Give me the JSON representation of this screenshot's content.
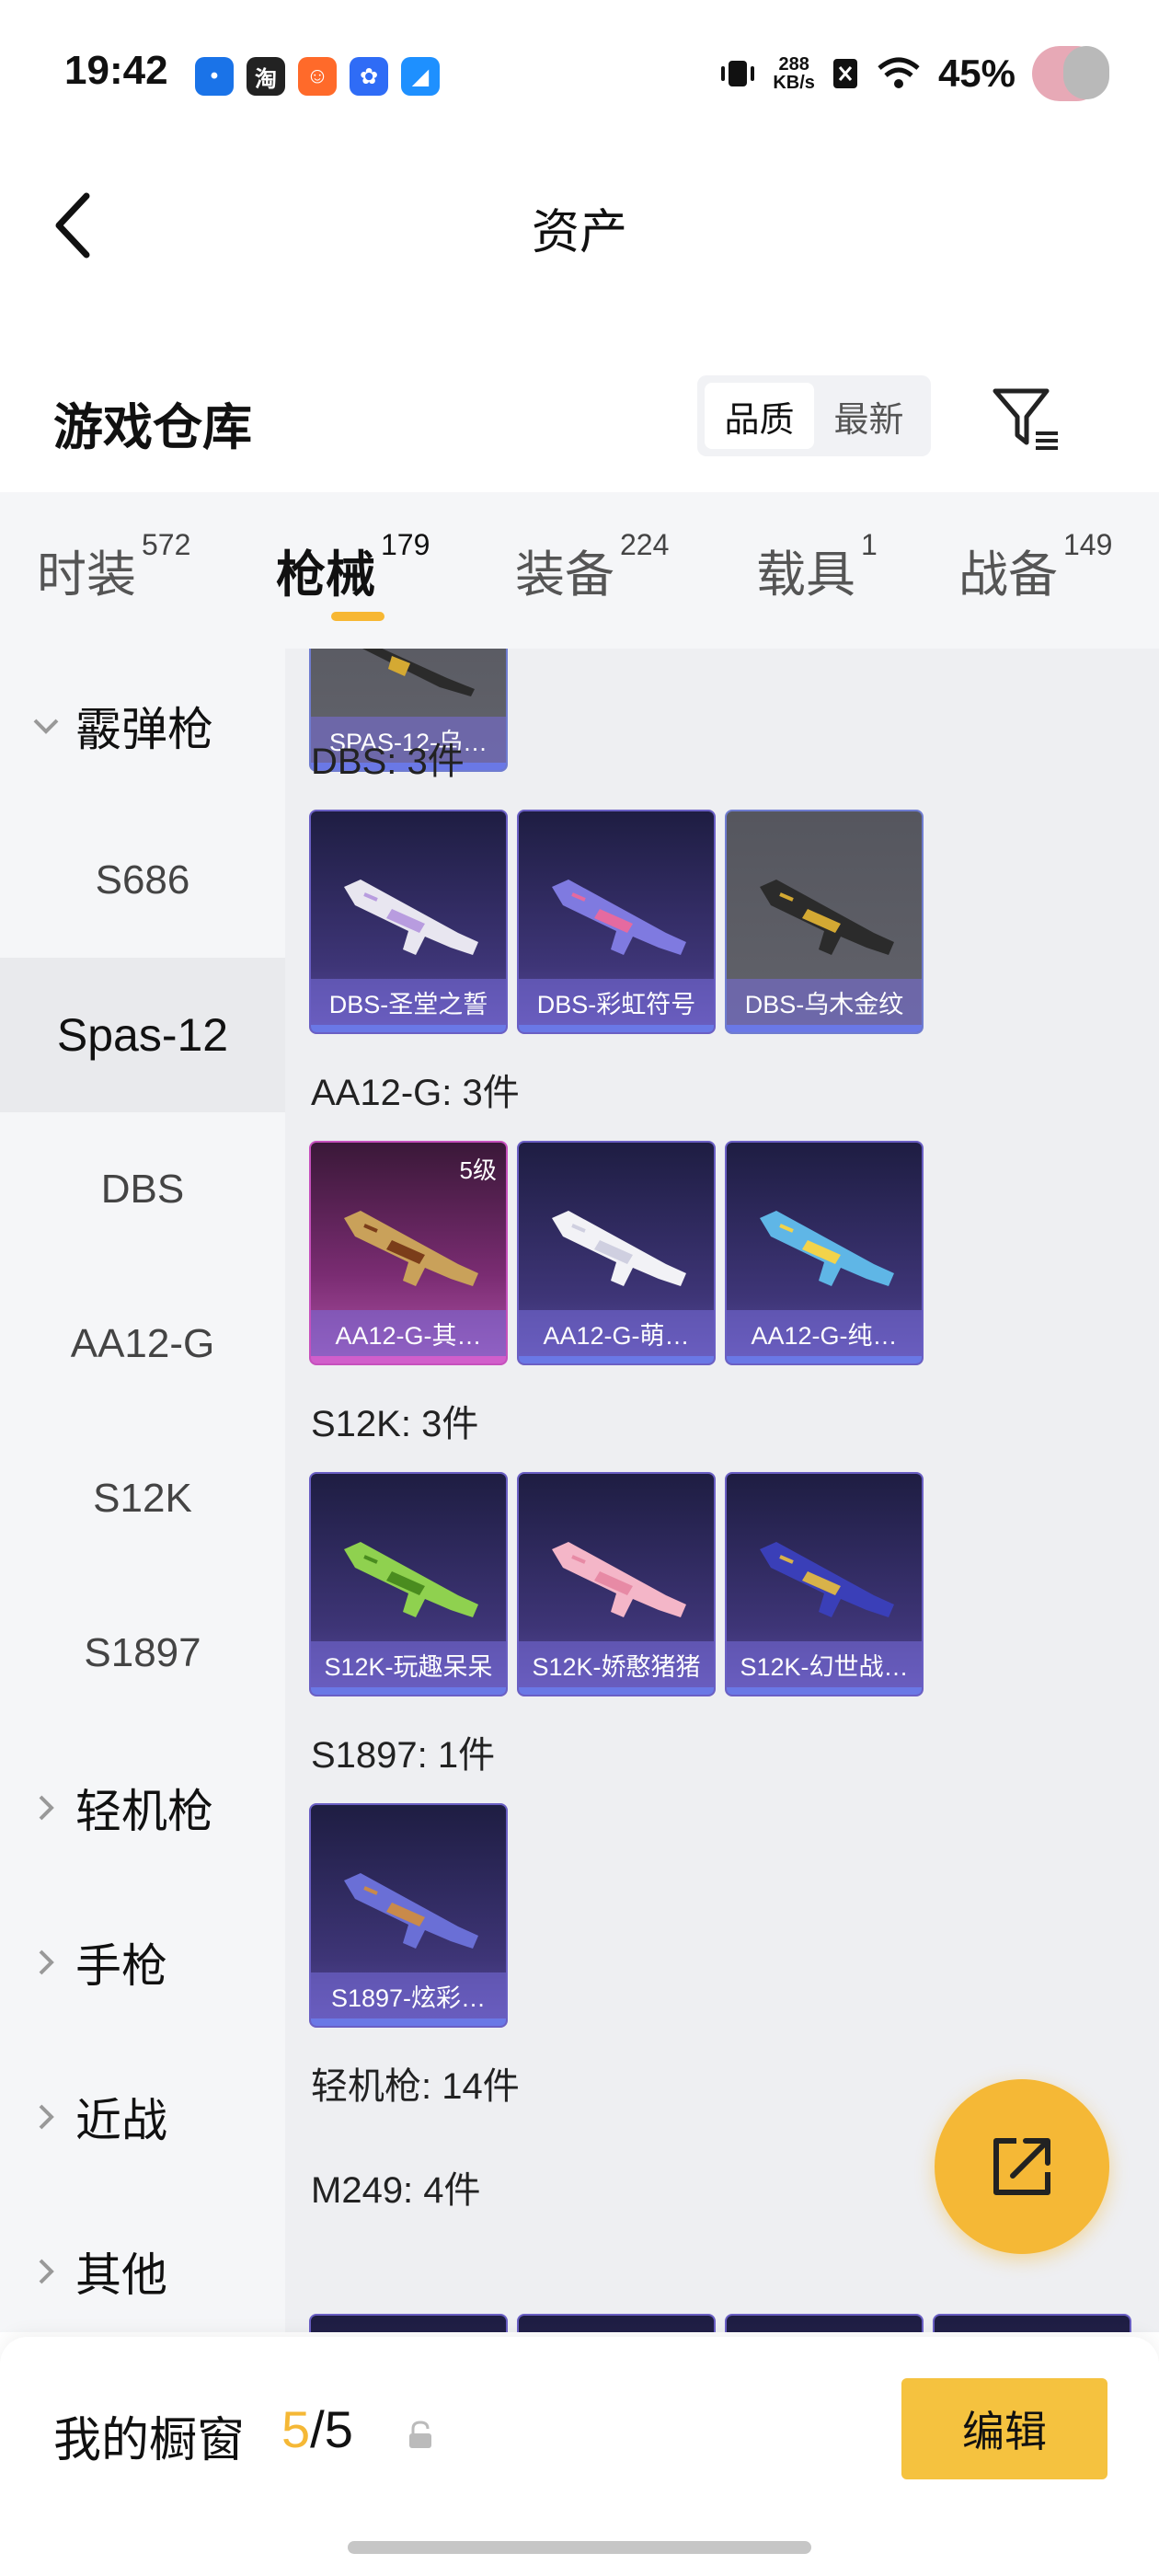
{
  "status_bar": {
    "time": "19:42",
    "net_speed_value": "288",
    "net_speed_unit": "KB/s",
    "battery": "45%",
    "apps": [
      {
        "name": "message-app-icon",
        "glyph": "•",
        "color": "#1a73e8"
      },
      {
        "name": "taobao-app-icon",
        "glyph": "淘",
        "color": "#222222"
      },
      {
        "name": "orange-app-icon",
        "glyph": "☺",
        "color": "#ff6a2a"
      },
      {
        "name": "blue-app-icon",
        "glyph": "✿",
        "color": "#2f6cf6"
      },
      {
        "name": "swift-app-icon",
        "glyph": "◢",
        "color": "#1e90ff"
      }
    ]
  },
  "header": {
    "title": "资产"
  },
  "warehouse": {
    "title": "游戏仓库",
    "sort_options": [
      "品质",
      "最新"
    ],
    "active_sort": "品质"
  },
  "tabs": [
    {
      "label": "时装",
      "count": "572"
    },
    {
      "label": "枪械",
      "count": "179"
    },
    {
      "label": "装备",
      "count": "224"
    },
    {
      "label": "载具",
      "count": "1"
    },
    {
      "label": "战备",
      "count": "149"
    }
  ],
  "active_tab": "枪械",
  "sidebar": {
    "group_open": "霰弹枪",
    "items": [
      "S686",
      "Spas-12",
      "DBS",
      "AA12-G",
      "S12K",
      "S1897"
    ],
    "active_item": "Spas-12",
    "groups_closed": [
      "轻机枪",
      "手枪",
      "近战",
      "其他"
    ]
  },
  "content": {
    "partial_card_label": "SPAS-12-乌…",
    "sections": [
      {
        "title": "DBS: 3件",
        "cards": [
          {
            "label": "DBS-圣堂之誓",
            "style": "purple",
            "gun_color": "#e8e6f0",
            "accent": "#b89cdf"
          },
          {
            "label": "DBS-彩虹符号",
            "style": "purple",
            "gun_color": "#7f7ae0",
            "accent": "#e56aa0"
          },
          {
            "label": "DBS-乌木金纹",
            "style": "grey",
            "gun_color": "#2b2b2b",
            "accent": "#d4a933"
          }
        ]
      },
      {
        "title": "AA12-G: 3件",
        "cards": [
          {
            "label": "AA12-G-其…",
            "style": "gold",
            "level": "5级",
            "gun_color": "#c9a15a",
            "accent": "#7b3d1a"
          },
          {
            "label": "AA12-G-萌…",
            "style": "purple",
            "gun_color": "#f2f2f6",
            "accent": "#cfcfe0"
          },
          {
            "label": "AA12-G-纯…",
            "style": "purple",
            "gun_color": "#5fb6e6",
            "accent": "#f2d34a"
          }
        ]
      },
      {
        "title": "S12K: 3件",
        "cards": [
          {
            "label": "S12K-玩趣呆呆",
            "style": "purple",
            "gun_color": "#8fd14f",
            "accent": "#4a8c1f"
          },
          {
            "label": "S12K-娇憨猪猪",
            "style": "purple",
            "gun_color": "#f4b6c8",
            "accent": "#e78aa5"
          },
          {
            "label": "S12K-幻世战…",
            "style": "purple",
            "gun_color": "#3a3fb8",
            "accent": "#d8b24a"
          }
        ]
      },
      {
        "title": "S1897: 1件",
        "cards": [
          {
            "label": "S1897-炫彩…",
            "style": "purple",
            "gun_color": "#6a6fd6",
            "accent": "#c98a4a"
          }
        ]
      }
    ],
    "lmg_title": "轻机枪: 14件",
    "m249_title": "M249: 4件"
  },
  "footer": {
    "title": "我的橱窗",
    "count_current": "5",
    "count_total": "/5",
    "edit_label": "编辑"
  },
  "colors": {
    "accent_yellow": "#f5b836",
    "card_border_purple": "#6a5fc4",
    "card_border_pink": "#c650bd"
  }
}
